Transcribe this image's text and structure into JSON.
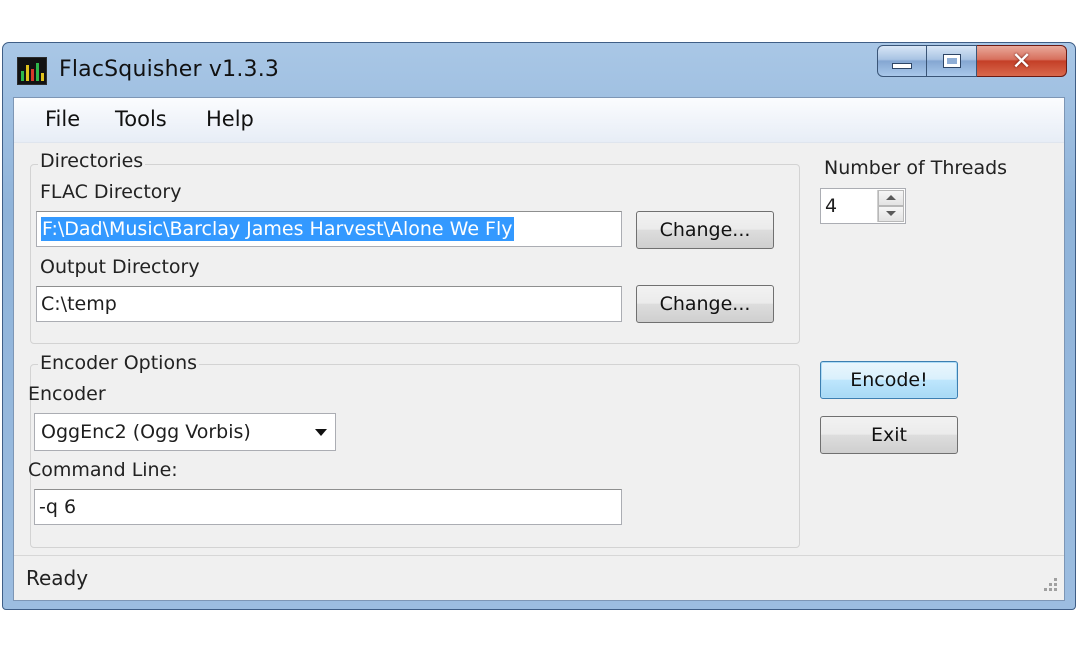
{
  "window": {
    "title": "FlacSquisher v1.3.3"
  },
  "menu": {
    "items": [
      "File",
      "Tools",
      "Help"
    ]
  },
  "directories": {
    "legend": "Directories",
    "flac_label": "FLAC Directory",
    "flac_value": "F:\\Dad\\Music\\Barclay James Harvest\\Alone We Fly",
    "flac_change": "Change...",
    "output_label": "Output Directory",
    "output_value": "C:\\temp",
    "output_change": "Change..."
  },
  "encoder_options": {
    "legend": "Encoder Options",
    "encoder_label": "Encoder",
    "encoder_value": "OggEnc2 (Ogg Vorbis)",
    "cmd_label": "Command Line:",
    "cmd_value": "-q 6"
  },
  "threads": {
    "label": "Number of Threads",
    "value": "4"
  },
  "actions": {
    "encode": "Encode!",
    "exit": "Exit"
  },
  "status": {
    "text": "Ready"
  }
}
